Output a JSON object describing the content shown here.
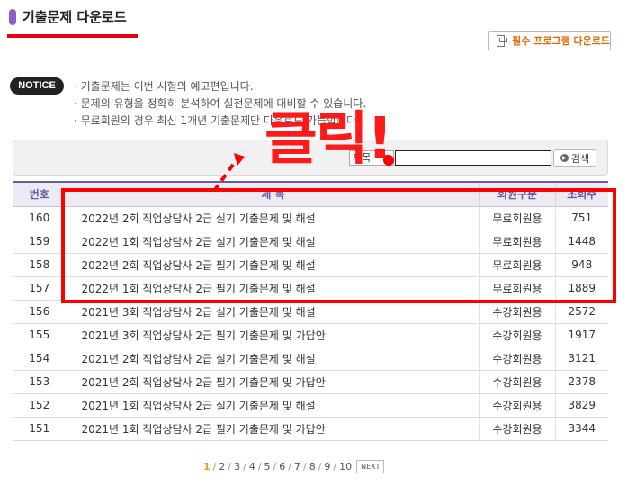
{
  "page": {
    "title": "기출문제 다운로드"
  },
  "header": {
    "required_program_button": "필수 프로그램 다운로드"
  },
  "notice": {
    "badge": "NOTICE",
    "lines": [
      "· 기출문제는 이번 시험의 예고편입니다.",
      "· 문제의 유형을 정확히 분석하여 실전문제에 대비할 수 있습니다.",
      "· 무료회원의 경우 최신 1개년 기출문제만 다운로드 가능합니다."
    ]
  },
  "search": {
    "select_value": "제목",
    "input_value": "",
    "button_label": "검색"
  },
  "table": {
    "headers": {
      "no": "번호",
      "subject": "제 목",
      "member_type": "회원구분",
      "views": "조회수"
    },
    "rows": [
      {
        "no": "160",
        "subject": "2022년 2회 직업상담사 2급 실기 기출문제 및 해설",
        "member": "무료회원용",
        "tier": "free",
        "views": "751"
      },
      {
        "no": "159",
        "subject": "2022년 1회 직업상담사 2급 실기 기출문제 및 해설",
        "member": "무료회원용",
        "tier": "free",
        "views": "1448"
      },
      {
        "no": "158",
        "subject": "2022년 2회 직업상담사 2급 필기 기출문제 및 해설",
        "member": "무료회원용",
        "tier": "free",
        "views": "948"
      },
      {
        "no": "157",
        "subject": "2022년 1회 직업상담사 2급 필기 기출문제 및 해설",
        "member": "무료회원용",
        "tier": "free",
        "views": "1889"
      },
      {
        "no": "156",
        "subject": "2021년 3회 직업상담사 2급 실기 기출문제 및 해설",
        "member": "수강회원용",
        "tier": "paid",
        "views": "2572"
      },
      {
        "no": "155",
        "subject": "2021년 3회 직업상담사 2급 필기 기출문제 및 가답안",
        "member": "수강회원용",
        "tier": "paid",
        "views": "1917"
      },
      {
        "no": "154",
        "subject": "2021년 2회 직업상담사 2급 실기 기출문제 및 해설",
        "member": "수강회원용",
        "tier": "paid",
        "views": "3121"
      },
      {
        "no": "153",
        "subject": "2021년 2회 직업상담사 2급 필기 기출문제 및 가답안",
        "member": "수강회원용",
        "tier": "paid",
        "views": "2378"
      },
      {
        "no": "152",
        "subject": "2021년 1회 직업상담사 2급 실기 기출문제 및 해설",
        "member": "수강회원용",
        "tier": "paid",
        "views": "3829"
      },
      {
        "no": "151",
        "subject": "2021년 1회 직업상담사 2급 필기 기출문제 및 가답안",
        "member": "수강회원용",
        "tier": "paid",
        "views": "3344"
      }
    ]
  },
  "pager": {
    "pages": [
      "1",
      "2",
      "3",
      "4",
      "5",
      "6",
      "7",
      "8",
      "9",
      "10"
    ],
    "current": "1",
    "next_label": "NEXT"
  },
  "annotation": {
    "click_text": "클릭!"
  },
  "colors": {
    "accent_purple": "#6a5aa0",
    "annotation_red": "#ff0000",
    "free_member": "#1e3a8a",
    "paid_member": "#c2187b"
  }
}
